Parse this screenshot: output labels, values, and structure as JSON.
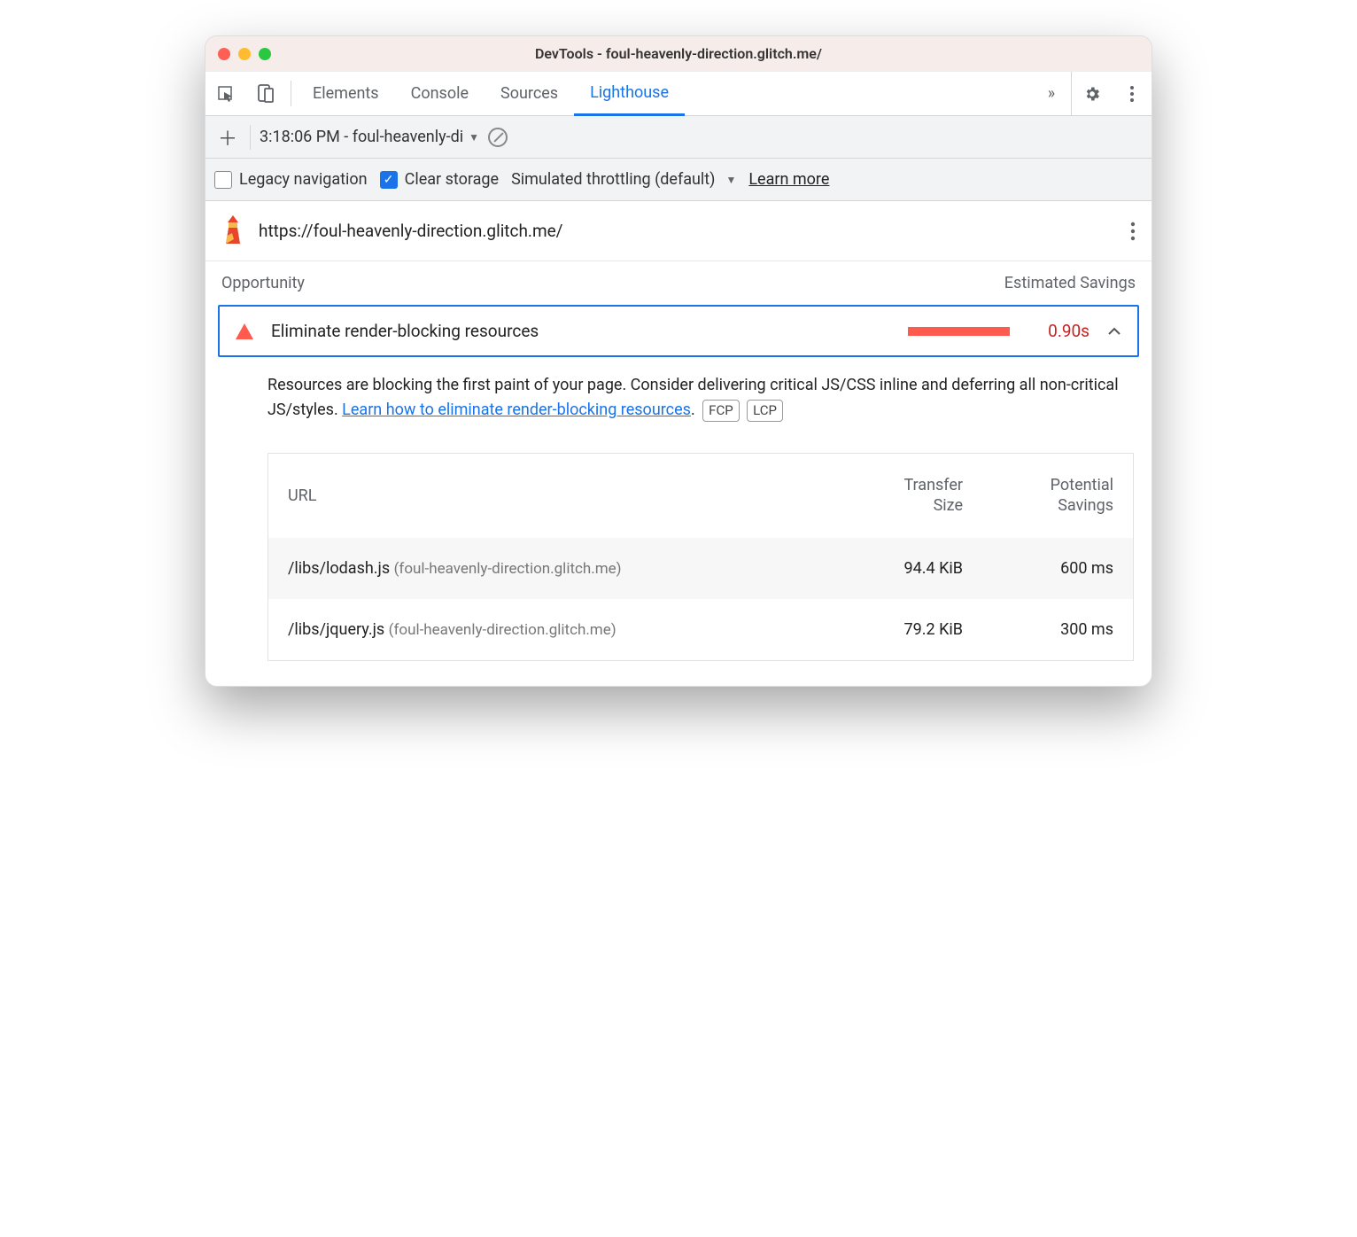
{
  "window": {
    "title": "DevTools - foul-heavenly-direction.glitch.me/"
  },
  "tabs": {
    "items": [
      "Elements",
      "Console",
      "Sources",
      "Lighthouse"
    ],
    "active": "Lighthouse"
  },
  "subbar": {
    "selected_report": "3:18:06 PM - foul-heavenly-di"
  },
  "options": {
    "legacy_label": "Legacy navigation",
    "legacy_checked": false,
    "clear_label": "Clear storage",
    "clear_checked": true,
    "throttle_label": "Simulated throttling (default)",
    "learn_more": "Learn more"
  },
  "report": {
    "url": "https://foul-heavenly-direction.glitch.me/"
  },
  "section": {
    "opportunity_label": "Opportunity",
    "savings_label": "Estimated Savings"
  },
  "audit": {
    "title": "Eliminate render-blocking resources",
    "value": "0.90s",
    "description_prefix": "Resources are blocking the first paint of your page. Consider delivering critical JS/CSS inline and deferring all non-critical JS/styles. ",
    "description_link": "Learn how to eliminate render-blocking resources",
    "chips": [
      "FCP",
      "LCP"
    ]
  },
  "table": {
    "headers": {
      "url": "URL",
      "size": "Transfer Size",
      "savings": "Potential Savings"
    },
    "rows": [
      {
        "path": "/libs/lodash.js",
        "host": "(foul-heavenly-direction.glitch.me)",
        "size": "94.4 KiB",
        "savings": "600 ms"
      },
      {
        "path": "/libs/jquery.js",
        "host": "(foul-heavenly-direction.glitch.me)",
        "size": "79.2 KiB",
        "savings": "300 ms"
      }
    ]
  }
}
